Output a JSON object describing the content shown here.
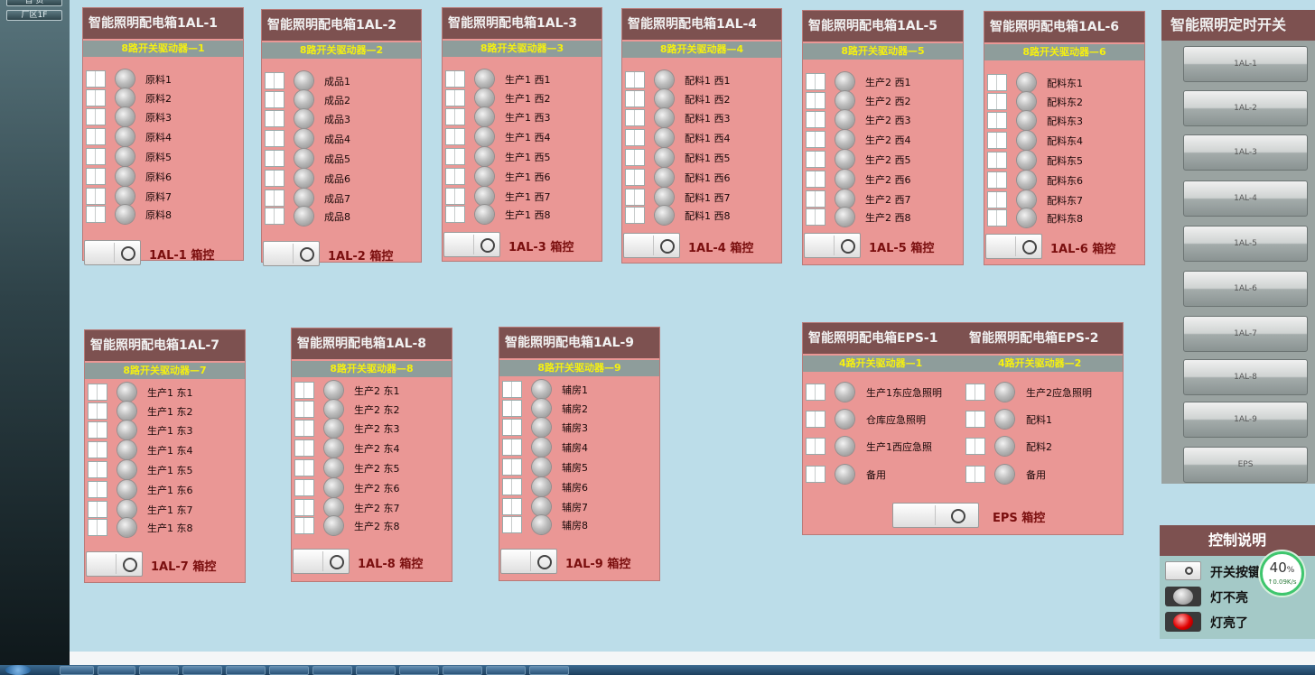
{
  "nav": {
    "btn1": "首 页",
    "btn2": "厂区1F"
  },
  "panels": [
    {
      "title": "智能照明配电箱1AL-1",
      "subtitle": "8路开关驱动器—1",
      "rows": [
        "原料1",
        "原料2",
        "原料3",
        "原料4",
        "原料5",
        "原料6",
        "原料7",
        "原料8"
      ],
      "ctl": "1AL-1 箱控"
    },
    {
      "title": "智能照明配电箱1AL-2",
      "subtitle": "8路开关驱动器—2",
      "rows": [
        "成品1",
        "成品2",
        "成品3",
        "成品4",
        "成品5",
        "成品6",
        "成品7",
        "成品8"
      ],
      "ctl": "1AL-2 箱控"
    },
    {
      "title": "智能照明配电箱1AL-3",
      "subtitle": "8路开关驱动器—3",
      "rows": [
        "生产1 西1",
        "生产1 西2",
        "生产1 西3",
        "生产1 西4",
        "生产1 西5",
        "生产1 西6",
        "生产1 西7",
        "生产1 西8"
      ],
      "ctl": "1AL-3 箱控"
    },
    {
      "title": "智能照明配电箱1AL-4",
      "subtitle": "8路开关驱动器—4",
      "rows": [
        "配料1 西1",
        "配料1 西2",
        "配料1 西3",
        "配料1 西4",
        "配料1 西5",
        "配料1 西6",
        "配料1 西7",
        "配料1 西8"
      ],
      "ctl": "1AL-4 箱控"
    },
    {
      "title": "智能照明配电箱1AL-5",
      "subtitle": "8路开关驱动器—5",
      "rows": [
        "生产2 西1",
        "生产2 西2",
        "生产2 西3",
        "生产2 西4",
        "生产2 西5",
        "生产2 西6",
        "生产2 西7",
        "生产2 西8"
      ],
      "ctl": "1AL-5 箱控"
    },
    {
      "title": "智能照明配电箱1AL-6",
      "subtitle": "8路开关驱动器—6",
      "rows": [
        "配料东1",
        "配料东2",
        "配料东3",
        "配料东4",
        "配料东5",
        "配料东6",
        "配料东7",
        "配料东8"
      ],
      "ctl": "1AL-6 箱控"
    },
    {
      "title": "智能照明配电箱1AL-7",
      "subtitle": "8路开关驱动器—7",
      "rows": [
        "生产1 东1",
        "生产1 东2",
        "生产1 东3",
        "生产1 东4",
        "生产1 东5",
        "生产1 东6",
        "生产1 东7",
        "生产1 东8"
      ],
      "ctl": "1AL-7 箱控"
    },
    {
      "title": "智能照明配电箱1AL-8",
      "subtitle": "8路开关驱动器—8",
      "rows": [
        "生产2 东1",
        "生产2 东2",
        "生产2 东3",
        "生产2 东4",
        "生产2 东5",
        "生产2 东6",
        "生产2 东7",
        "生产2 东8"
      ],
      "ctl": "1AL-8 箱控"
    },
    {
      "title": "智能照明配电箱1AL-9",
      "subtitle": "8路开关驱动器—9",
      "rows": [
        "辅房1",
        "辅房2",
        "辅房3",
        "辅房4",
        "辅房5",
        "辅房6",
        "辅房7",
        "辅房8"
      ],
      "ctl": "1AL-9 箱控"
    }
  ],
  "eps": {
    "title1": "智能照明配电箱EPS-1",
    "title2": "智能照明配电箱EPS-2",
    "sub1": "4路开关驱动器—1",
    "sub2": "4路开关驱动器—2",
    "rows1": [
      "生产1东应急照明",
      "仓库应急照明",
      "生产1西应急照",
      "备用"
    ],
    "rows2": [
      "生产2应急照明",
      "配料1",
      "配料2",
      "备用"
    ],
    "ctl": "EPS 箱控"
  },
  "timer": {
    "title": "智能照明定时开关",
    "buttons": [
      "1AL-1",
      "1AL-2",
      "1AL-3",
      "1AL-4",
      "1AL-5",
      "1AL-6",
      "1AL-7",
      "1AL-8",
      "1AL-9",
      "EPS"
    ]
  },
  "legend": {
    "title": "控制说明",
    "switch_label": "开关按键",
    "off_label": "灯不亮",
    "on_label": "灯亮了"
  },
  "net_widget": {
    "percent": "40",
    "percent_unit": "%",
    "speed": "↑0.09K/s"
  },
  "colors": {
    "panel_bg": "#ea9795",
    "title_bg": "#7d5150",
    "subtitle_text": "#f5f010",
    "ctl_label": "#7a0e0e",
    "lamp_on": "#e00000",
    "page_bg": "#bcdde9"
  }
}
